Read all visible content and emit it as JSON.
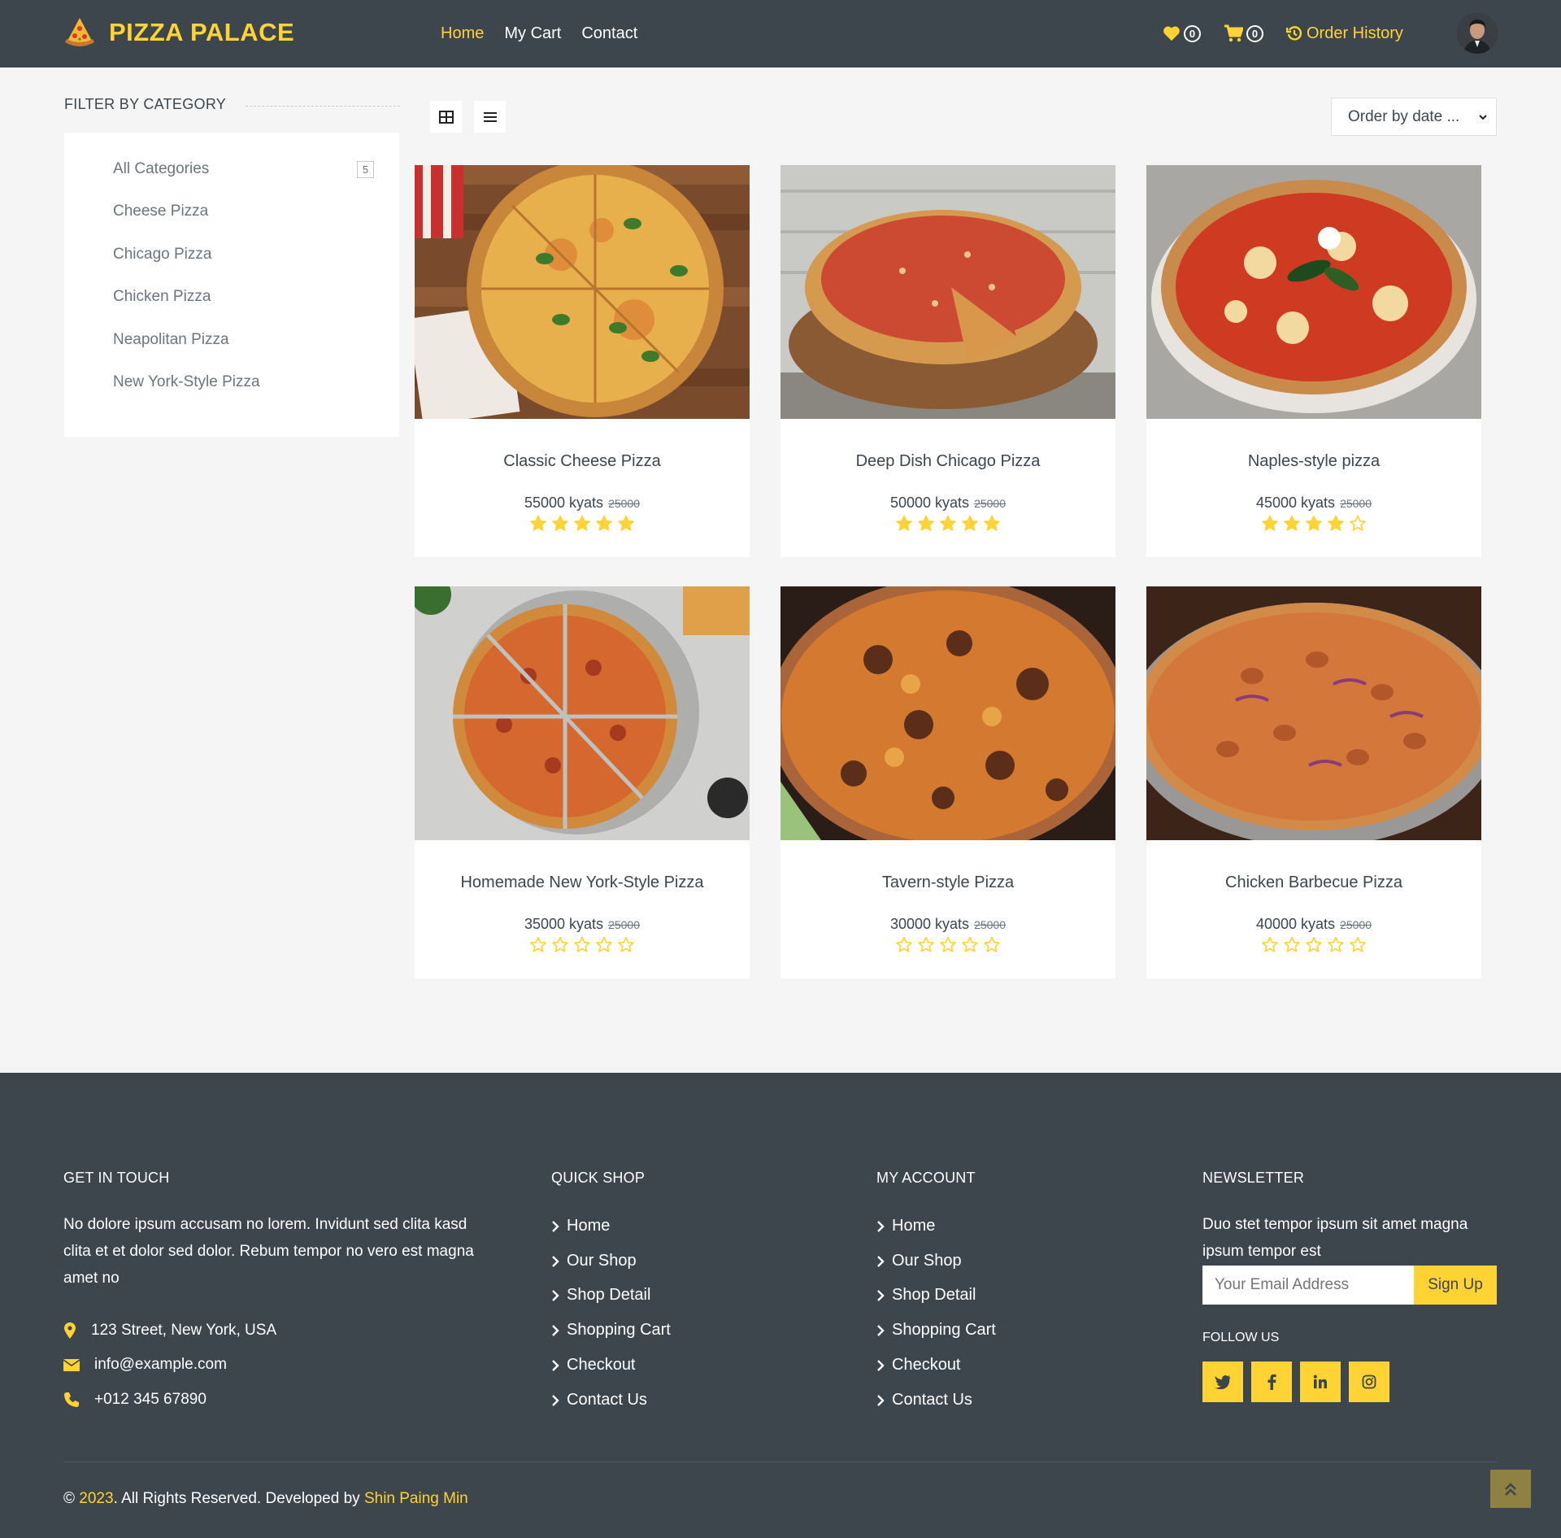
{
  "brand": {
    "name": "PIZZA PALACE",
    "accent": "#ffd333",
    "dark": "#3d464d"
  },
  "nav": {
    "links": [
      {
        "label": "Home",
        "active": true
      },
      {
        "label": "My Cart"
      },
      {
        "label": "Contact"
      }
    ],
    "wishlist_count": "0",
    "cart_count": "0",
    "order_history": "Order History"
  },
  "sidebar": {
    "title": "Filter by category",
    "all_count": "5",
    "categories": [
      "All Categories",
      "Cheese Pizza",
      "Chicago Pizza",
      "Chicken Pizza",
      "Neapolitan Pizza",
      "New York-Style Pizza"
    ]
  },
  "toolbar": {
    "order_select": "Order by date ..."
  },
  "products": [
    {
      "name": "Classic Cheese Pizza",
      "price": "55000 kyats",
      "old_price": "25000",
      "rating": 5
    },
    {
      "name": "Deep Dish Chicago Pizza",
      "price": "50000 kyats",
      "old_price": "25000",
      "rating": 5
    },
    {
      "name": "Naples-style pizza",
      "price": "45000 kyats",
      "old_price": "25000",
      "rating": 4
    },
    {
      "name": "Homemade New York-Style Pizza",
      "price": "35000 kyats",
      "old_price": "25000",
      "rating": 0
    },
    {
      "name": "Tavern-style Pizza",
      "price": "30000 kyats",
      "old_price": "25000",
      "rating": 0
    },
    {
      "name": "Chicken Barbecue Pizza",
      "price": "40000 kyats",
      "old_price": "25000",
      "rating": 0
    }
  ],
  "footer": {
    "get_in_touch": {
      "title": "Get In Touch",
      "text": "No dolore ipsum accusam no lorem. Invidunt sed clita kasd clita et et dolor sed dolor. Rebum tempor no vero est magna amet no",
      "address": "123 Street, New York, USA",
      "email": "info@example.com",
      "phone": "+012 345 67890"
    },
    "quick_shop": {
      "title": "Quick Shop",
      "links": [
        "Home",
        "Our Shop",
        "Shop Detail",
        "Shopping Cart",
        "Checkout",
        "Contact Us"
      ]
    },
    "my_account": {
      "title": "My Account",
      "links": [
        "Home",
        "Our Shop",
        "Shop Detail",
        "Shopping Cart",
        "Checkout",
        "Contact Us"
      ]
    },
    "newsletter": {
      "title": "Newsletter",
      "text": "Duo stet tempor ipsum sit amet magna ipsum tempor est",
      "placeholder": "Your Email Address",
      "button": "Sign Up",
      "follow": "Follow Us",
      "socials": [
        "twitter-icon",
        "facebook-icon",
        "linkedin-icon",
        "instagram-icon"
      ]
    },
    "copyright": {
      "prefix": "© ",
      "year": "2023",
      "middle": ". All Rights Reserved. Developed by ",
      "author": "Shin Paing Min"
    }
  }
}
